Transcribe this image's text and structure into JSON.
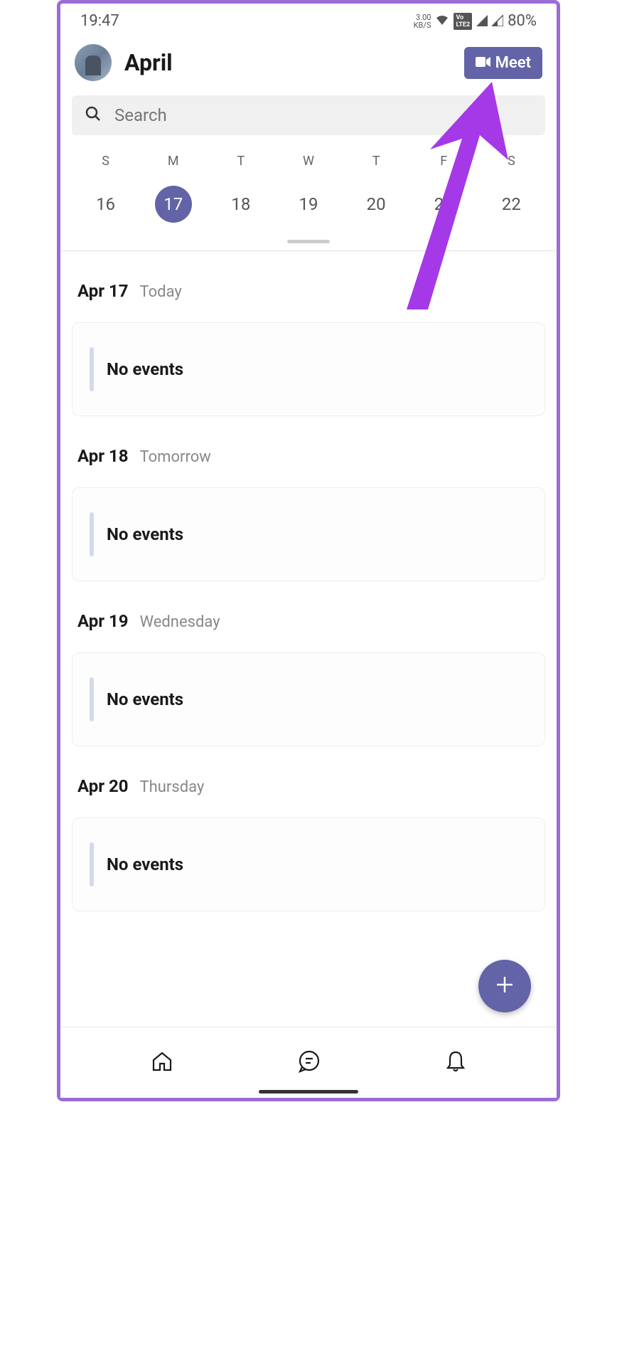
{
  "status": {
    "time": "19:47",
    "kbs_top": "3.00",
    "kbs_bottom": "KB/S",
    "volte": "VoLTE2",
    "battery": "80%"
  },
  "header": {
    "month": "April",
    "meet_label": "Meet"
  },
  "search": {
    "placeholder": "Search"
  },
  "week": {
    "labels": [
      "S",
      "M",
      "T",
      "W",
      "T",
      "F",
      "S"
    ],
    "days": [
      "16",
      "17",
      "18",
      "19",
      "20",
      "21",
      "22"
    ],
    "selected_index": 1
  },
  "agenda": [
    {
      "date": "Apr 17",
      "label": "Today",
      "event": "No events"
    },
    {
      "date": "Apr 18",
      "label": "Tomorrow",
      "event": "No events"
    },
    {
      "date": "Apr 19",
      "label": "Wednesday",
      "event": "No events"
    },
    {
      "date": "Apr 20",
      "label": "Thursday",
      "event": "No events"
    }
  ],
  "colors": {
    "primary": "#6264a7",
    "annotation": "#a539e8"
  }
}
